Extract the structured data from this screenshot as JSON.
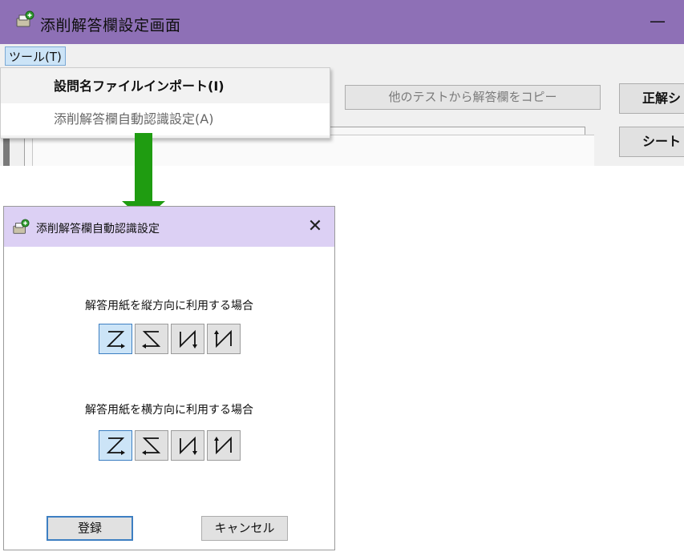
{
  "main_window": {
    "title": "添削解答欄設定画面",
    "minimize_glyph": "—",
    "menu_tools_label": "ツール(T)",
    "copy_from_test_label": "他のテストから解答欄をコピー",
    "right_button_1_label": "正解シ",
    "right_button_2_label": "シート",
    "dropdown": {
      "items": [
        {
          "label": "設問名ファイルインポート(I)"
        },
        {
          "label": "添削解答欄自動認識設定(A)"
        }
      ]
    }
  },
  "dialog": {
    "title": "添削解答欄自動認識設定",
    "close_glyph": "✕",
    "portrait": {
      "label": "解答用紙を縦方向に利用する場合",
      "selected_index": 0,
      "options": [
        "z-pattern-icon",
        "reverse-z-pattern-icon",
        "n-pattern-icon",
        "reverse-n-pattern-icon"
      ]
    },
    "landscape": {
      "label": "解答用紙を横方向に利用する場合",
      "selected_index": 0,
      "options": [
        "z-pattern-icon",
        "reverse-z-pattern-icon",
        "n-pattern-icon",
        "reverse-n-pattern-icon"
      ]
    },
    "register_label": "登録",
    "cancel_label": "キャンセル"
  },
  "colors": {
    "main_titlebar": "#8e70b6",
    "dialog_titlebar": "#dcd0f4",
    "arrow": "#1f9c11",
    "selected_button": "#cce4f7"
  }
}
